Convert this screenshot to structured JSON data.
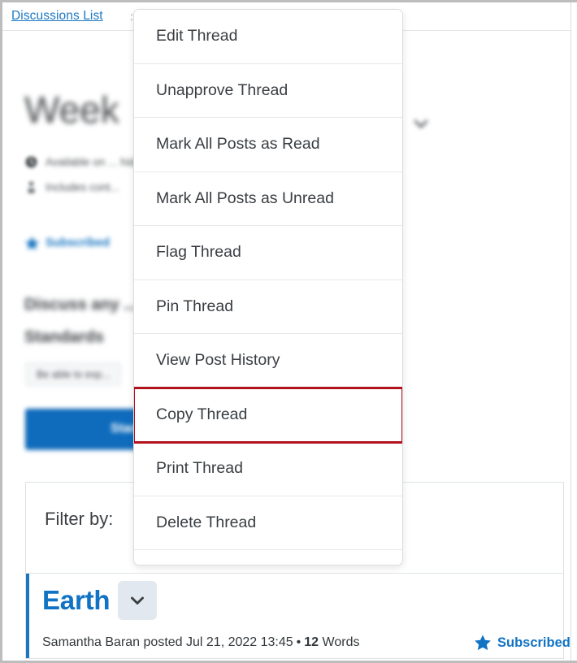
{
  "breadcrumb": {
    "link_label": "Discussions List",
    "separator": ":"
  },
  "thread": {
    "title": "Week",
    "availability_note": "Available on  ...  hidden before availability starts.",
    "include_note": "Includes cont...",
    "subscribed_label": "Subscribed",
    "body_line_1": "Discuss any   ...   r lecture on the Big",
    "body_line_2": "Standards",
    "rubric_chip": "Be able to exp...",
    "start_thread_button": "Start a New..."
  },
  "filter": {
    "label": "Filter by:"
  },
  "post": {
    "title": "Earth",
    "caret_icon": "chevron-down-icon",
    "author": "Samantha Baran",
    "meta_prefix": "Samantha Baran posted Jul 21, 2022 13:45",
    "posted_date": "Jul 21, 2022 13:45",
    "bullet": "•",
    "word_count": "12",
    "word_label": "Words",
    "subscribed_label": "Subscribed",
    "subscribed_icon": "star-icon"
  },
  "context_menu": {
    "items": [
      {
        "label": "Edit Thread",
        "highlighted": false
      },
      {
        "label": "Unapprove Thread",
        "highlighted": false
      },
      {
        "label": "Mark All Posts as Read",
        "highlighted": false
      },
      {
        "label": "Mark All Posts as Unread",
        "highlighted": false
      },
      {
        "label": "Flag Thread",
        "highlighted": false
      },
      {
        "label": "Pin Thread",
        "highlighted": false
      },
      {
        "label": "View Post History",
        "highlighted": false
      },
      {
        "label": "Copy Thread",
        "highlighted": true
      },
      {
        "label": "Print Thread",
        "highlighted": false
      },
      {
        "label": "Delete Thread",
        "highlighted": false
      }
    ]
  },
  "colors": {
    "link_blue": "#1c77c3",
    "title_blue": "#1173c4",
    "button_blue": "#0f6cbd",
    "highlight_red": "#b3131f",
    "menu_text": "#3a3e42",
    "border_gray": "#dfe3e6"
  }
}
